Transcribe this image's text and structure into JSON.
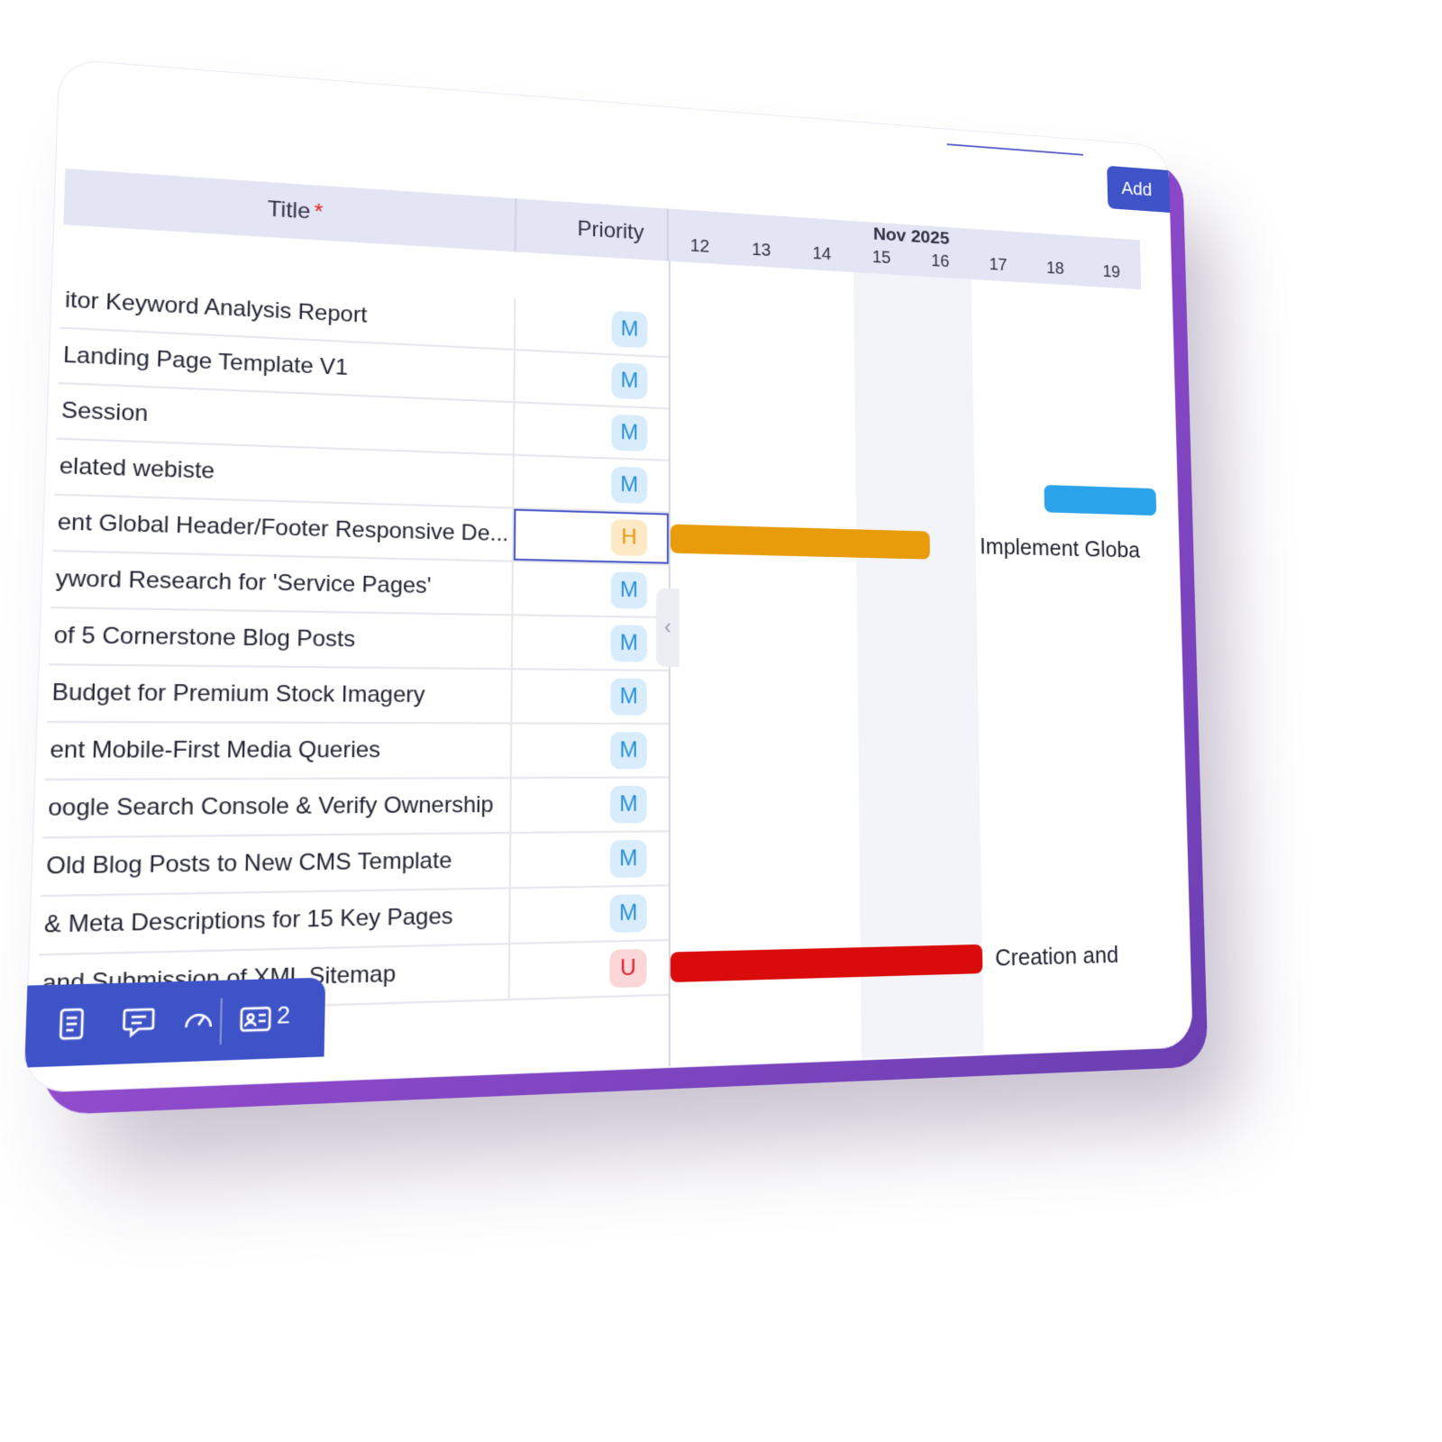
{
  "toolbar": {
    "add_label": "Add"
  },
  "grid": {
    "title_header": "Title",
    "required_marker": "*",
    "priority_header": "Priority",
    "month_label": "Nov 2025",
    "days": [
      "12",
      "13",
      "14",
      "15",
      "16",
      "17",
      "18",
      "19"
    ]
  },
  "rows": [
    {
      "title": "itor Keyword Analysis Report",
      "priority": "M"
    },
    {
      "title": "Landing Page Template V1",
      "priority": "M"
    },
    {
      "title": "Session",
      "priority": "M"
    },
    {
      "title": "elated webiste",
      "priority": "M"
    },
    {
      "title": "ent Global Header/Footer Responsive De...",
      "priority": "H",
      "selected": true
    },
    {
      "title": "yword Research for 'Service Pages'",
      "priority": "M"
    },
    {
      "title": "of 5 Cornerstone Blog Posts",
      "priority": "M"
    },
    {
      "title": "Budget for Premium Stock Imagery",
      "priority": "M"
    },
    {
      "title": "ent Mobile-First Media Queries",
      "priority": "M"
    },
    {
      "title": "oogle Search Console & Verify Ownership",
      "priority": "M"
    },
    {
      "title": "Old Blog Posts to New CMS Template",
      "priority": "M"
    },
    {
      "title": "& Meta Descriptions for 15 Key Pages",
      "priority": "M"
    },
    {
      "title": "and Submission of XML Sitemap",
      "priority": "U"
    }
  ],
  "timeline": {
    "bars": [
      {
        "row": 4,
        "color": "#e89c0c",
        "label": "Implement Globa"
      },
      {
        "row": 12,
        "color": "#d90b0b",
        "label": "Creation and"
      },
      {
        "row": 3,
        "color": "#2aa3ea",
        "label": ""
      }
    ]
  },
  "bottom_toolbar": {
    "icons": [
      "notes-icon",
      "comment-icon",
      "gauge-icon",
      "contact-card-icon"
    ],
    "count": "2"
  }
}
